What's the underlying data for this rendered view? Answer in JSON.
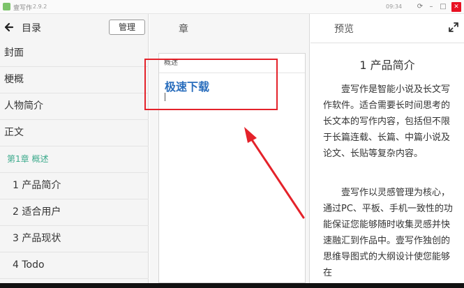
{
  "titlebar": {
    "app_name": "壹写作",
    "version": "2.9.2",
    "time": "09:34",
    "icons": [
      "refresh-icon",
      "minimize-icon",
      "maximize-icon",
      "close-icon"
    ]
  },
  "left_panel": {
    "title": "目录",
    "manage_label": "管理",
    "items": [
      {
        "label": "封面",
        "type": "item"
      },
      {
        "label": "梗概",
        "type": "item"
      },
      {
        "label": "人物简介",
        "type": "item"
      },
      {
        "label": "正文",
        "type": "item"
      },
      {
        "label": "第1章 概述",
        "type": "chapter"
      },
      {
        "label": "1 产品简介",
        "type": "section"
      },
      {
        "label": "2 适合用户",
        "type": "section"
      },
      {
        "label": "3 产品现状",
        "type": "section"
      },
      {
        "label": "4 Todo",
        "type": "section"
      }
    ]
  },
  "middle_panel": {
    "title": "章",
    "card_title": "概述",
    "card_text": "极速下载"
  },
  "right_panel": {
    "title": "预览",
    "preview_title": "1 产品简介",
    "paragraphs": [
      "壹写作是智能小说及长文写作软件。适合需要长时间思考的长文本的写作内容，包括但不限于长篇连载、长篇、中篇小说及论文、长贴等复杂内容。",
      "壹写作以灵感管理为核心，通过PC、平板、手机一致性的功能保证您能够随时收集灵感并快速融汇到作品中。壹写作独创的思维导图式的大纲设计使您能够在"
    ]
  },
  "colors": {
    "accent_green": "#3eab8d",
    "link_blue": "#2a6ebd",
    "annotation_red": "#e4222a"
  }
}
